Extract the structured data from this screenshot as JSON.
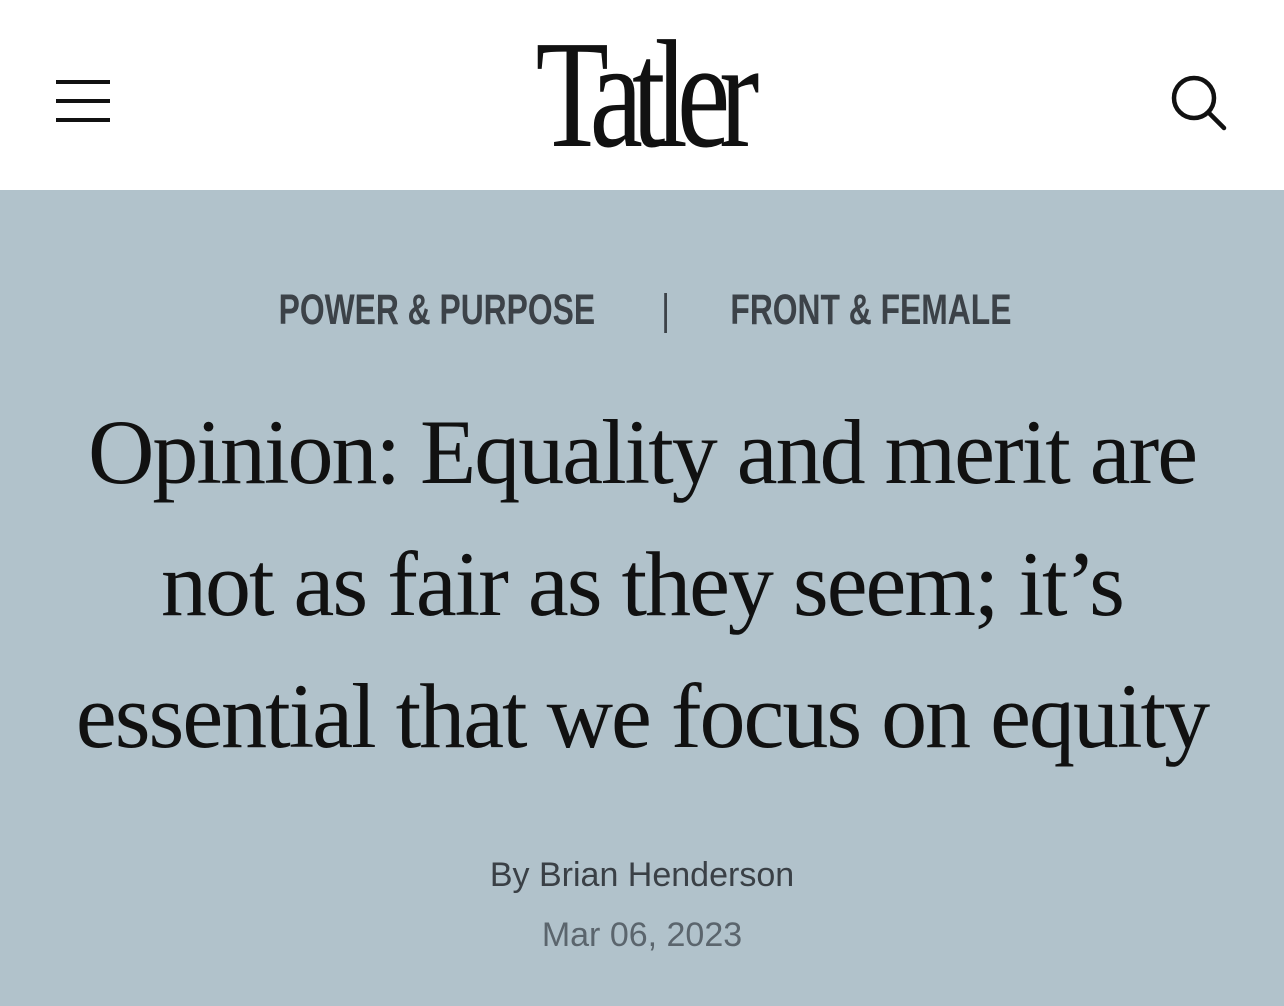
{
  "header": {
    "logo": "Tatler",
    "menu_icon": "hamburger-menu-icon",
    "search_icon": "search-icon"
  },
  "article": {
    "categories": [
      "POWER & PURPOSE",
      "FRONT & FEMALE"
    ],
    "separator": "|",
    "headline": "Opinion: Equality and merit are not as fair as they seem; it’s essential that we focus on equity",
    "byline_prefix": "By ",
    "author": "Brian Henderson",
    "date": "Mar 06, 2023"
  },
  "colors": {
    "header_bg": "#ffffff",
    "hero_bg": "#b1c2cb",
    "text_dark": "#111111",
    "category_text": "#3c4248",
    "date_text": "#5b656d"
  }
}
